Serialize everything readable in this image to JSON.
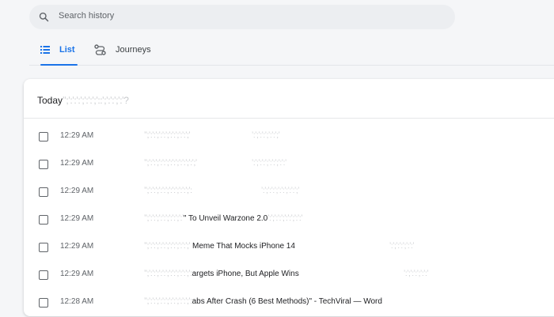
{
  "search": {
    "placeholder": "Search history",
    "icon": "search-icon"
  },
  "tabs": [
    {
      "label": "List",
      "icon": "list-icon",
      "active": true
    },
    {
      "label": "Journeys",
      "icon": "journeys-icon",
      "active": false
    }
  ],
  "card": {
    "title_prefix": "Today"
  },
  "entries": [
    {
      "time": "12:29 AM",
      "title_text": ""
    },
    {
      "time": "12:29 AM",
      "title_text": ""
    },
    {
      "time": "12:29 AM",
      "title_text": ""
    },
    {
      "time": "12:29 AM",
      "title_text": "\" To Unveil Warzone 2.0"
    },
    {
      "time": "12:29 AM",
      "title_text": "Meme That Mocks iPhone 14"
    },
    {
      "time": "12:29 AM",
      "title_text": "argets iPhone, But Apple Wins"
    },
    {
      "time": "12:28 AM",
      "title_text": "abs After Crash (6 Best Methods)\" - TechViral — Word"
    }
  ],
  "colors": {
    "accent": "#1a73e8",
    "background": "#f5f6f8"
  }
}
